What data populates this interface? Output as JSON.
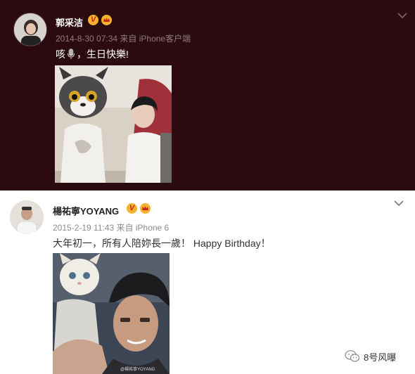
{
  "posts": [
    {
      "username": "郭采洁",
      "badge": "V",
      "meta": "2014-8-30 07:34 来自 iPhone客户端",
      "content_before": "咳",
      "content_after": "，生日快樂!",
      "image_desc": "photo-cat-mask-and-woman",
      "background_color": "#2b0b0f"
    },
    {
      "username": "楊祐寧YOYANG",
      "badge": "V",
      "meta": "2015-2-19 11:43 来自 iPhone 6",
      "content": "大年初一，所有人陪妳長一歲！ Happy Birthday！",
      "image_desc": "photo-cat-mask-and-man",
      "photo_watermark": "@楊祐寧YOYANG",
      "background_color": "#ffffff"
    }
  ],
  "watermark": {
    "text": "8号风曝",
    "icon": "wechat-icon"
  },
  "colors": {
    "vip_badge": "#f8b12c",
    "vip_text": "#c4281b"
  }
}
